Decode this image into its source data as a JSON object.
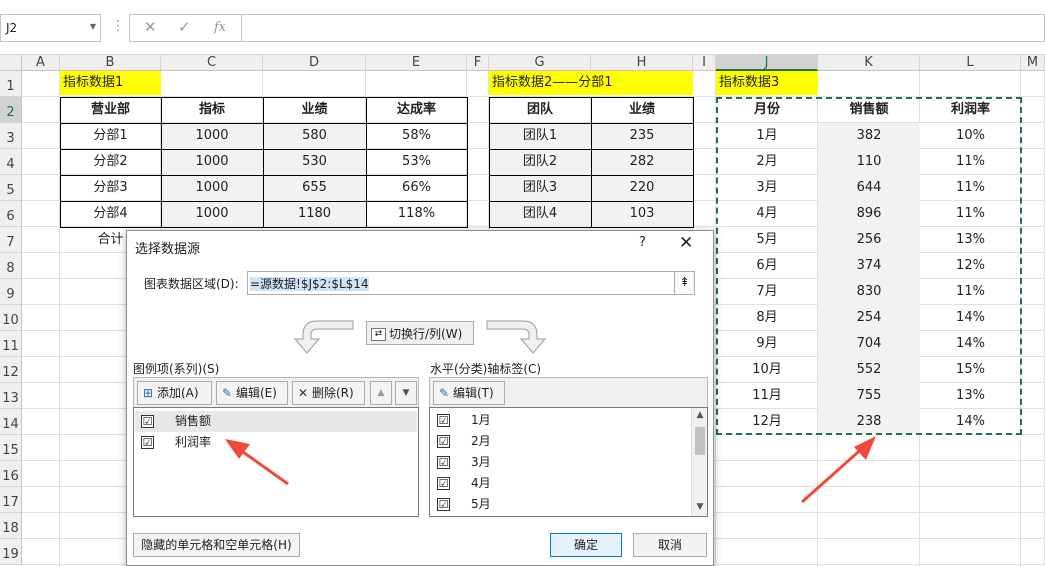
{
  "formula_bar": {
    "name_box": "J2",
    "cancel_glyph": "✕",
    "enter_glyph": "✓",
    "fx_glyph": "fx",
    "formula": ""
  },
  "sheet": {
    "columns": [
      "A",
      "B",
      "C",
      "D",
      "E",
      "F",
      "G",
      "H",
      "I",
      "J",
      "K",
      "L",
      "M"
    ],
    "rows": [
      "1",
      "2",
      "3",
      "4",
      "5",
      "6",
      "7",
      "8",
      "9",
      "10",
      "11",
      "12",
      "13",
      "14",
      "15",
      "16",
      "17",
      "18",
      "19"
    ],
    "table1": {
      "title": "指标数据1",
      "headers": [
        "营业部",
        "指标",
        "业绩",
        "达成率"
      ],
      "rows": [
        [
          "分部1",
          "1000",
          "580",
          "58%"
        ],
        [
          "分部2",
          "1000",
          "530",
          "53%"
        ],
        [
          "分部3",
          "1000",
          "655",
          "66%"
        ],
        [
          "分部4",
          "1000",
          "1180",
          "118%"
        ]
      ],
      "total_label": "合计"
    },
    "table2": {
      "title": "指标数据2——分部1",
      "headers": [
        "团队",
        "业绩"
      ],
      "rows": [
        [
          "团队1",
          "235"
        ],
        [
          "团队2",
          "282"
        ],
        [
          "团队3",
          "220"
        ],
        [
          "团队4",
          "103"
        ]
      ]
    },
    "table3": {
      "title": "指标数据3",
      "headers": [
        "月份",
        "销售额",
        "利润率"
      ],
      "rows": [
        [
          "1月",
          "382",
          "10%"
        ],
        [
          "2月",
          "110",
          "11%"
        ],
        [
          "3月",
          "644",
          "11%"
        ],
        [
          "4月",
          "896",
          "11%"
        ],
        [
          "5月",
          "256",
          "13%"
        ],
        [
          "6月",
          "374",
          "12%"
        ],
        [
          "7月",
          "830",
          "11%"
        ],
        [
          "8月",
          "254",
          "14%"
        ],
        [
          "9月",
          "704",
          "14%"
        ],
        [
          "10月",
          "552",
          "15%"
        ],
        [
          "11月",
          "755",
          "13%"
        ],
        [
          "12月",
          "238",
          "14%"
        ]
      ]
    }
  },
  "dialog": {
    "title": "选择数据源",
    "help": "?",
    "close": "✕",
    "range_label": "图表数据区域(D):",
    "range_value": "=源数据!$J$2:$L$14",
    "switch_label": "切换行/列(W)",
    "legend_group_label": "图例项(系列)(S)",
    "legend_buttons": {
      "add": "添加(A)",
      "edit": "编辑(E)",
      "delete": "删除(R)",
      "up": "▲",
      "down": "▼"
    },
    "series": [
      {
        "label": "销售额",
        "checked": "☑"
      },
      {
        "label": "利润率",
        "checked": "☑"
      }
    ],
    "axis_group_label": "水平(分类)轴标签(C)",
    "axis_edit_label": "编辑(T)",
    "axis_labels": [
      "1月",
      "2月",
      "3月",
      "4月",
      "5月"
    ],
    "hidden_cells_label": "隐藏的单元格和空单元格(H)",
    "ok_label": "确定",
    "cancel_label": "取消"
  },
  "colors": {
    "accent_green": "#217346",
    "title_fill": "#ffff00",
    "arrow_red": "#f04a3c"
  }
}
